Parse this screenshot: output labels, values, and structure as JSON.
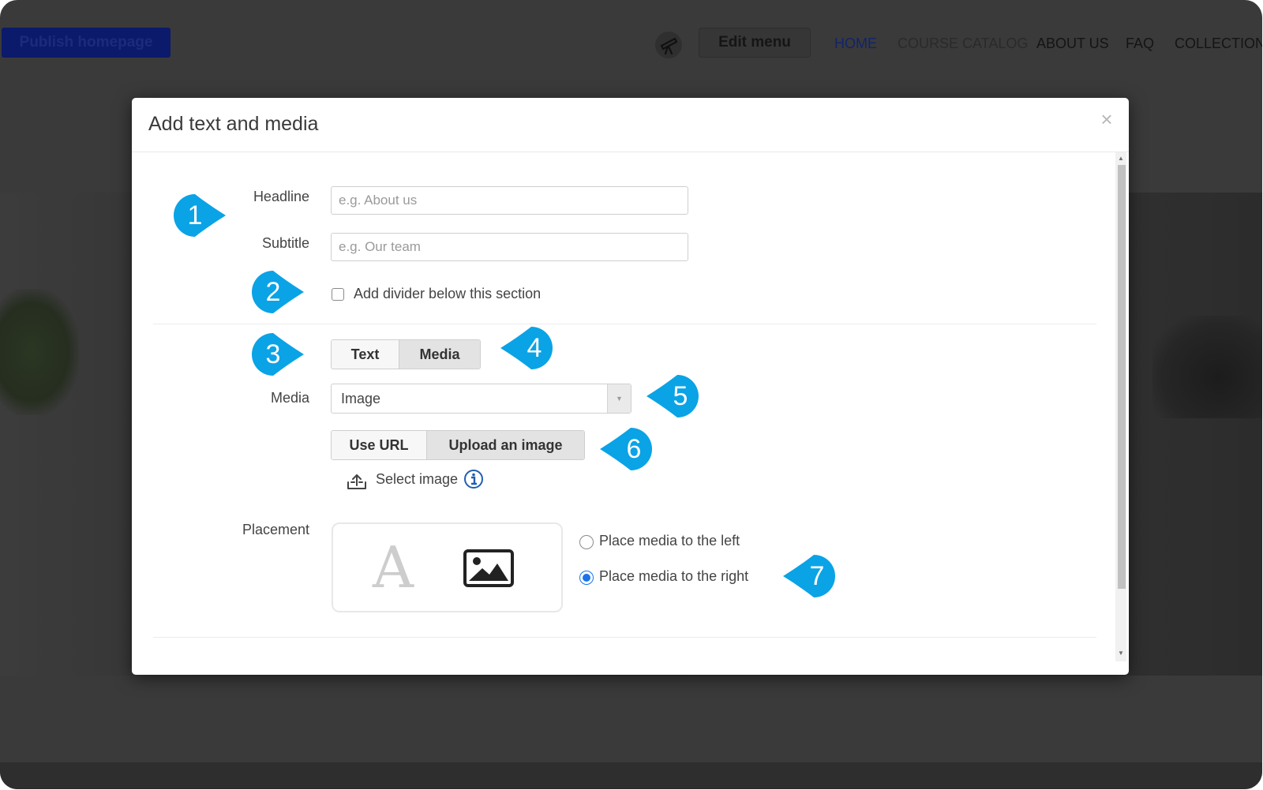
{
  "background": {
    "publish_button": "Publish homepage",
    "icon": "telescope-icon",
    "edit_menu_button": "Edit menu",
    "nav": [
      "HOME",
      "COURSE CATALOG",
      "ABOUT US",
      "FAQ",
      "COLLECTION"
    ],
    "active_nav": "HOME"
  },
  "modal": {
    "title": "Add text and media",
    "close": "×",
    "headline_label": "Headline",
    "headline_placeholder": "e.g. About us",
    "headline_value": "",
    "subtitle_label": "Subtitle",
    "subtitle_placeholder": "e.g. Our team",
    "subtitle_value": "",
    "divider_label": "Add divider below this section",
    "divider_checked": false,
    "content_toggle": [
      "Text",
      "Media"
    ],
    "content_selected": "Media",
    "media_label": "Media",
    "media_value": "Image",
    "source_toggle": [
      "Use URL",
      "Upload an image"
    ],
    "source_selected": "Upload an image",
    "select_image": "Select image",
    "placement_label": "Placement",
    "placement_preview_letter": "A",
    "placement_options": [
      "Place media to the left",
      "Place media to the right"
    ],
    "placement_selected": "Place media to the right"
  },
  "callouts": [
    "1",
    "2",
    "3",
    "4",
    "5",
    "6",
    "7"
  ],
  "colors": {
    "callout": "#0aa3e6",
    "radio_accent": "#1a73e8",
    "publish_button": "#0b1a6b",
    "backdrop": "#3a3a3a"
  }
}
